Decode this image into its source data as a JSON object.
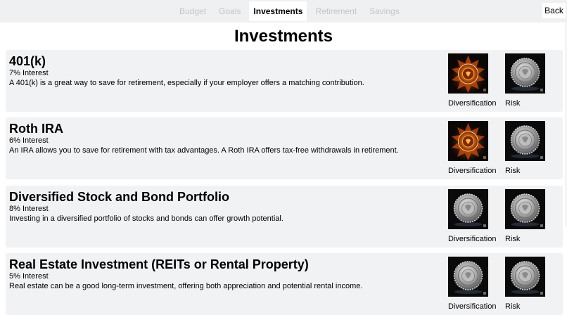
{
  "nav": {
    "tabs": [
      {
        "label": "Budget"
      },
      {
        "label": "Goals"
      },
      {
        "label": "Investments",
        "active": true
      },
      {
        "label": "Retirement"
      },
      {
        "label": "Savings"
      }
    ],
    "back_label": "Back"
  },
  "page": {
    "title": "Investments"
  },
  "investments": [
    {
      "name": "401(k)",
      "interest": "7% Interest",
      "description": "A 401(k) is a great way to save for retirement, especially if your employer offers a matching contribution.",
      "diversification_label": "Diversification",
      "risk_label": "Risk",
      "diversification_icon": "fire-medallion-icon",
      "risk_icon": "silver-medallion-icon"
    },
    {
      "name": "Roth IRA",
      "interest": "6% Interest",
      "description": "An IRA allows you to save for retirement with tax advantages. A Roth IRA offers tax-free withdrawals in retirement.",
      "diversification_label": "Diversification",
      "risk_label": "Risk",
      "diversification_icon": "fire-medallion-icon",
      "risk_icon": "silver-medallion-icon"
    },
    {
      "name": "Diversified Stock and Bond Portfolio",
      "interest": "8% Interest",
      "description": "Investing in a diversified portfolio of stocks and bonds can offer growth potential.",
      "diversification_label": "Diversification",
      "risk_label": "Risk",
      "diversification_icon": "silver-medallion-icon",
      "risk_icon": "silver-medallion-icon"
    },
    {
      "name": "Real Estate Investment (REITs or Rental Property)",
      "interest": "5% Interest",
      "description": "Real estate can be a good long-term investment, offering both appreciation and potential rental income.",
      "diversification_label": "Diversification",
      "risk_label": "Risk",
      "diversification_icon": "silver-medallion-icon",
      "risk_icon": "silver-medallion-icon"
    }
  ],
  "colors": {
    "nav_background": "#eef0f2",
    "inactive_tab_text": "#c3c6c9",
    "card_background": "#f1f2f4",
    "flame_accent": "#e8741c"
  }
}
